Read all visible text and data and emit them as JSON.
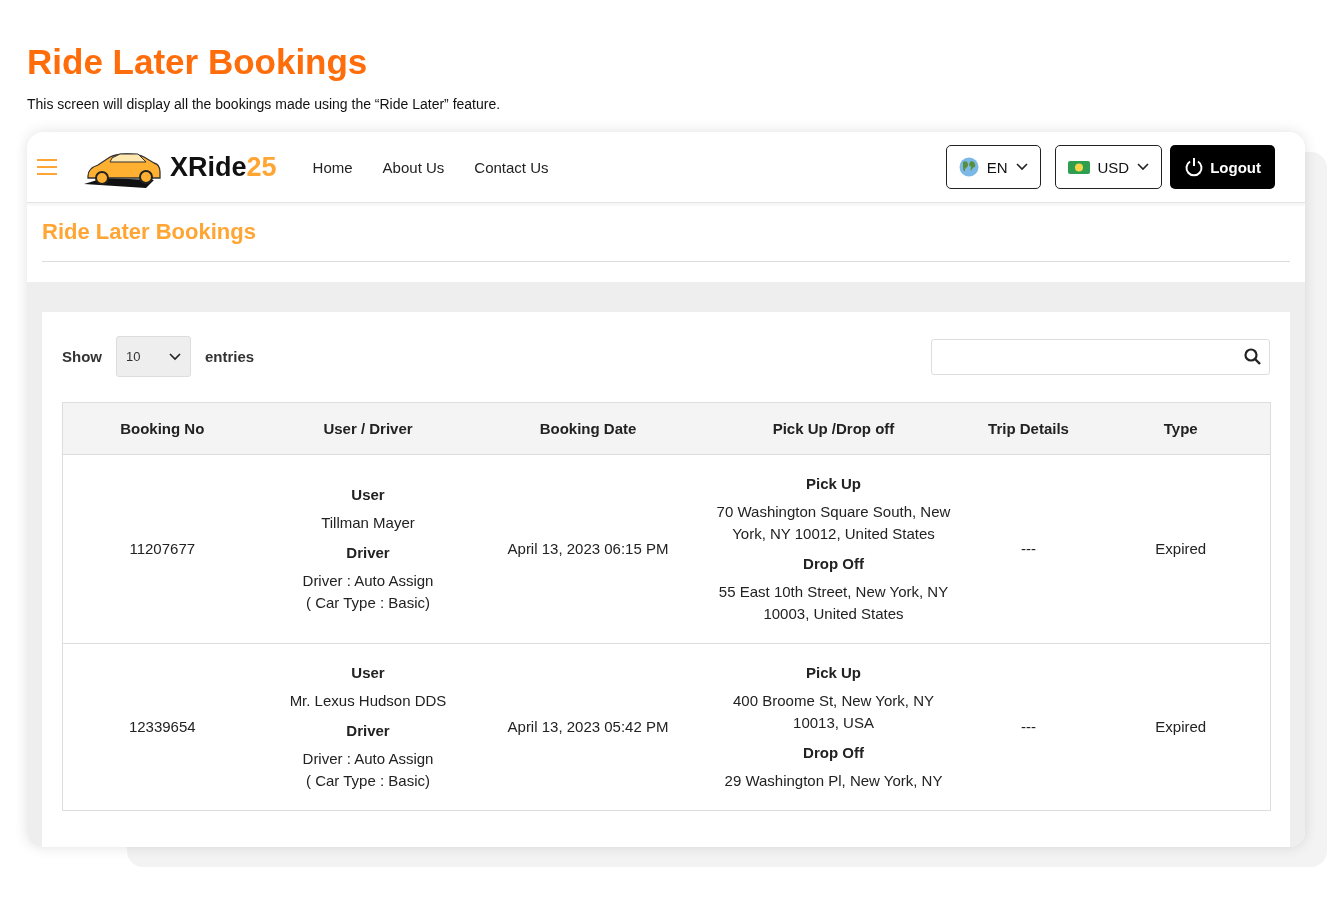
{
  "page": {
    "title": "Ride Later Bookings",
    "description": "This screen will display all the bookings made using the “Ride Later” feature."
  },
  "navbar": {
    "logo": {
      "name": "XRide",
      "number": "25"
    },
    "links": [
      {
        "label": "Home"
      },
      {
        "label": "About Us"
      },
      {
        "label": "Contact Us"
      }
    ],
    "language": "EN",
    "currency": "USD",
    "logout": "Logout"
  },
  "section_title": "Ride Later Bookings",
  "table_controls": {
    "show_label": "Show",
    "page_size": "10",
    "entries_label": "entries"
  },
  "table": {
    "columns": [
      "Booking No",
      "User / Driver",
      "Booking Date",
      "Pick Up /Drop off",
      "Trip Details",
      "Type"
    ],
    "rows": [
      {
        "booking_no": "11207677",
        "user_label": "User",
        "user": "Tillman Mayer",
        "driver_label": "Driver",
        "driver": "Driver : Auto Assign",
        "car_type": "( Car Type : Basic)",
        "date": "April 13, 2023 06:15 PM",
        "pickup_label": "Pick Up",
        "pickup": "70 Washington Square South, New York, NY 10012, United States",
        "dropoff_label": "Drop Off",
        "dropoff": "55 East 10th Street, New York, NY 10003, United States",
        "trip_details": "---",
        "type": "Expired"
      },
      {
        "booking_no": "12339654",
        "user_label": "User",
        "user": "Mr. Lexus Hudson DDS",
        "driver_label": "Driver",
        "driver": "Driver : Auto Assign",
        "car_type": "( Car Type : Basic)",
        "date": "April 13, 2023 05:42 PM",
        "pickup_label": "Pick Up",
        "pickup": "400 Broome St, New York, NY 10013, USA",
        "dropoff_label": "Drop Off",
        "dropoff": "29 Washington Pl, New York, NY",
        "trip_details": "---",
        "type": "Expired"
      }
    ]
  }
}
